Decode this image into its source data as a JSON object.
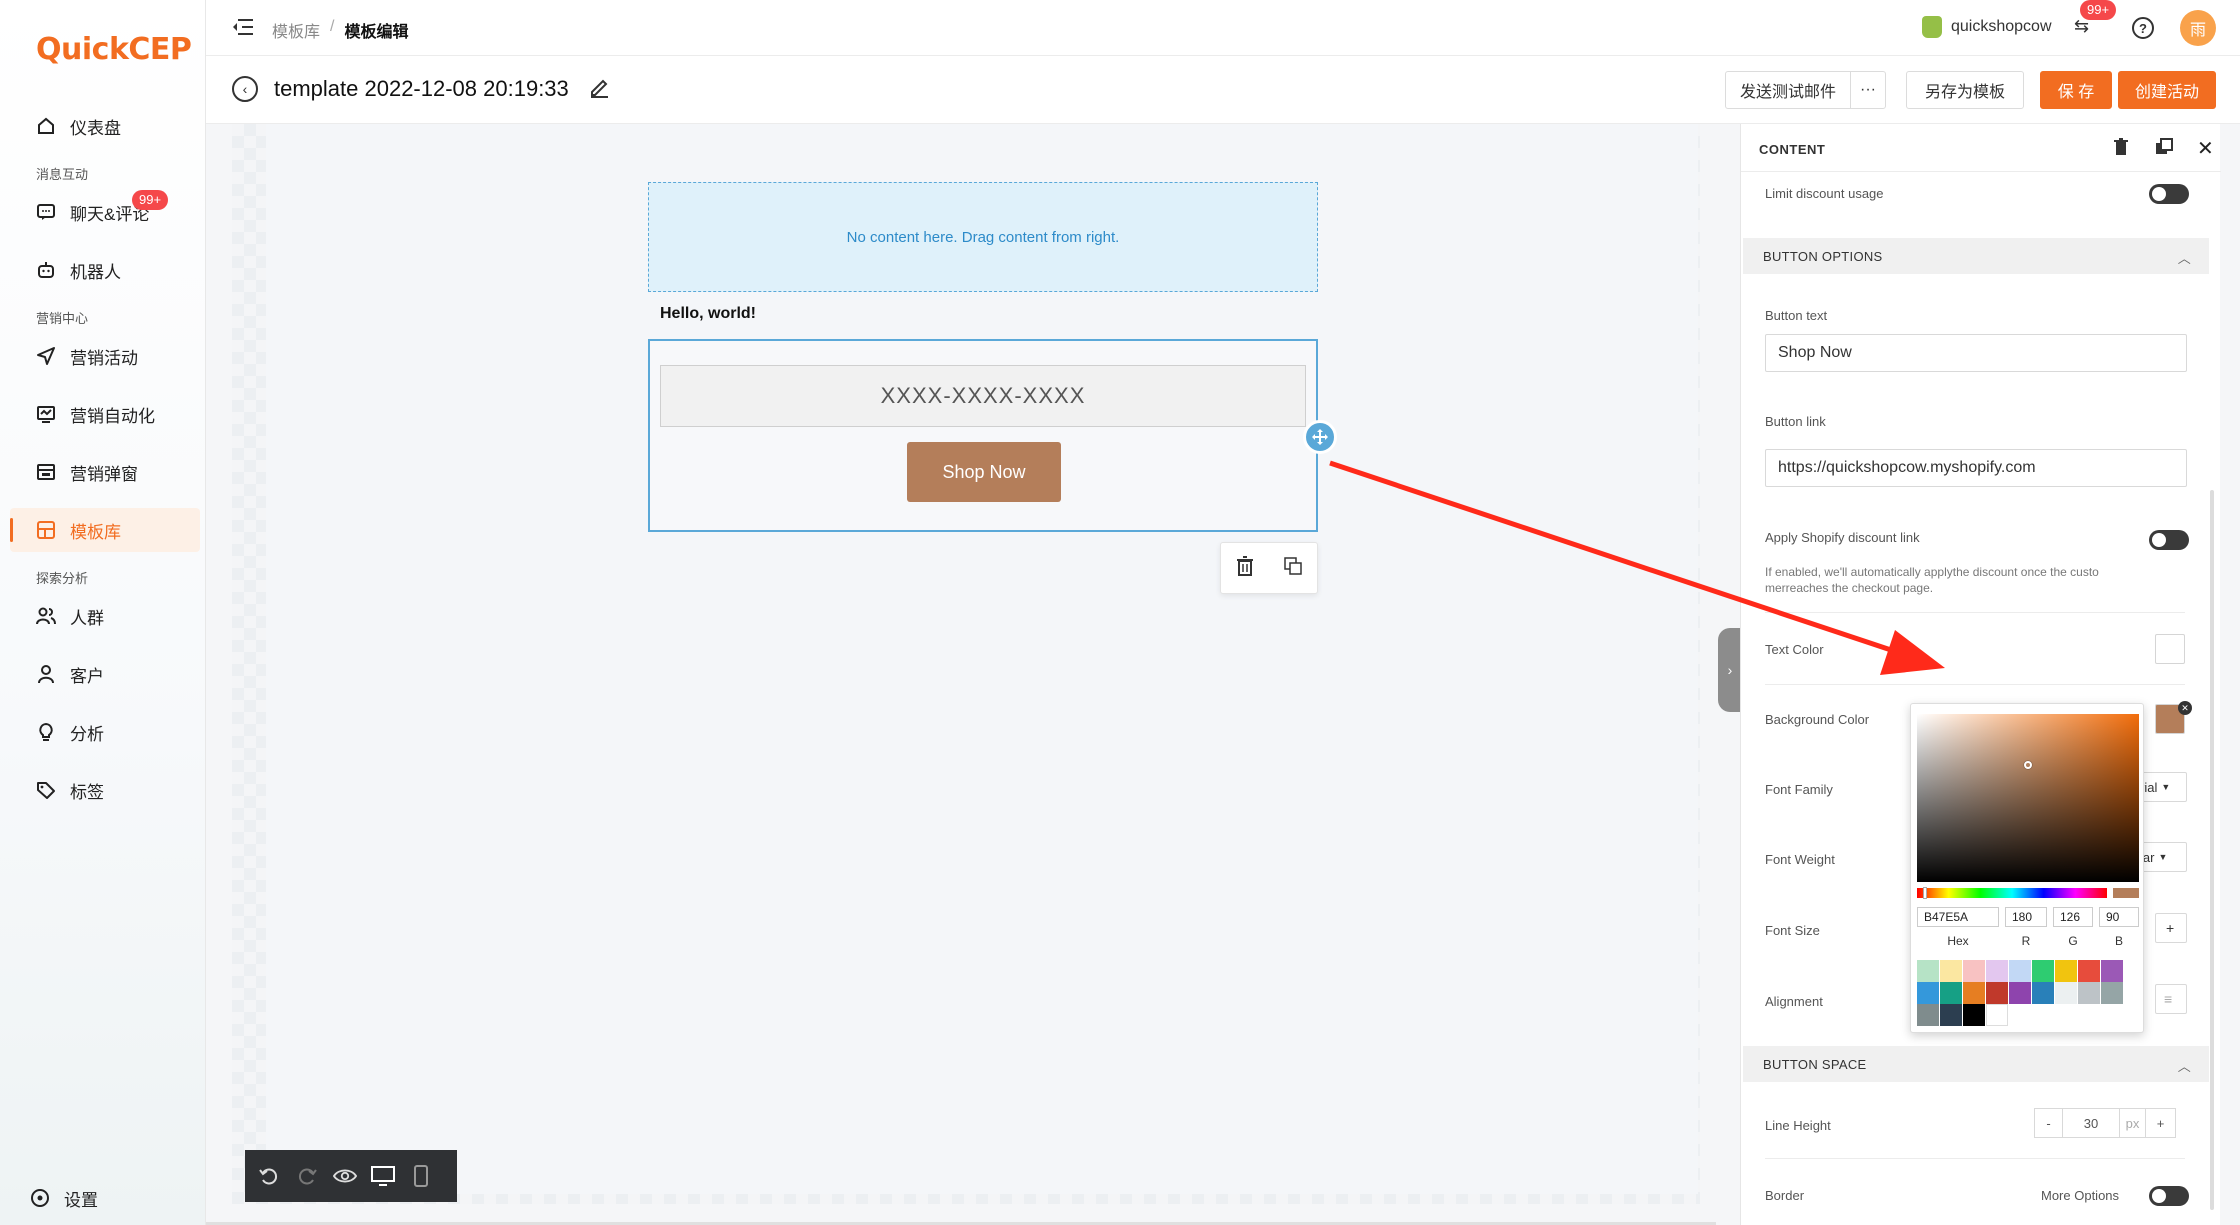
{
  "app": {
    "logo_q": "Q",
    "logo_uick": "uick",
    "logo_cep": "CEP"
  },
  "sidebar": {
    "items": [
      {
        "label": "仪表盘",
        "icon": "home-icon"
      },
      {
        "group": "消息互动"
      },
      {
        "label": "聊天&评论",
        "icon": "chat-icon",
        "badge": "99+"
      },
      {
        "label": "机器人",
        "icon": "robot-icon"
      },
      {
        "group": "营销中心"
      },
      {
        "label": "营销活动",
        "icon": "send-icon"
      },
      {
        "label": "营销自动化",
        "icon": "automation-icon"
      },
      {
        "label": "营销弹窗",
        "icon": "popup-icon"
      },
      {
        "label": "模板库",
        "icon": "template-icon",
        "active": true
      },
      {
        "group": "探索分析"
      },
      {
        "label": "人群",
        "icon": "group-icon"
      },
      {
        "label": "客户",
        "icon": "user-icon"
      },
      {
        "label": "分析",
        "icon": "bulb-icon"
      },
      {
        "label": "标签",
        "icon": "tag-icon"
      }
    ],
    "settings_label": "设置"
  },
  "topbar": {
    "breadcrumb_parent": "模板库",
    "breadcrumb_sep": "/",
    "breadcrumb_current": "模板编辑",
    "store_name": "quickshopcow",
    "notif_badge": "99+",
    "avatar_text": "雨"
  },
  "titlebar": {
    "title": "template 2022-12-08 20:19:33",
    "send_test_label": "发送测试邮件",
    "more_label": "···",
    "save_as_template_label": "另存为模板",
    "save_label": "保 存",
    "create_campaign_label": "创建活动"
  },
  "canvas": {
    "dropzone_text": "No content here. Drag content from right.",
    "hello_text": "Hello, world!",
    "code_placeholder": "XXXX-XXXX-XXXX",
    "shop_button_text": "Shop Now"
  },
  "panel": {
    "header": "CONTENT",
    "limit_discount_label": "Limit discount usage",
    "button_options_header": "BUTTON OPTIONS",
    "button_text_label": "Button text",
    "button_text_value": "Shop Now",
    "button_link_label": "Button link",
    "button_link_value": "https://quickshopcow.myshopify.com",
    "apply_shopify_label": "Apply Shopify discount link",
    "apply_shopify_desc_1": "If enabled, we'll automatically applythe discount once the custo",
    "apply_shopify_desc_2": "merreaches the checkout page.",
    "text_color_label": "Text Color",
    "background_color_label": "Background Color",
    "font_family_label": "Font Family",
    "font_family_value_partial": "rial",
    "font_weight_label": "Font Weight",
    "font_weight_value_partial": "lar",
    "font_size_label": "Font Size",
    "alignment_label": "Alignment",
    "button_space_header": "BUTTON SPACE",
    "line_height_label": "Line Height",
    "line_height_minus": "-",
    "line_height_value": "30",
    "line_height_unit": "px",
    "line_height_plus": "+",
    "font_size_plus": "+",
    "border_label": "Border",
    "more_options_label": "More Options"
  },
  "color_picker": {
    "hex_value": "B47E5A",
    "r_value": "180",
    "g_value": "126",
    "b_value": "90",
    "hex_label": "Hex",
    "r_label": "R",
    "g_label": "G",
    "b_label": "B",
    "current_color": "#b47e5a",
    "presets": [
      "#b6e3c6",
      "#fbe7a1",
      "#f8c2c2",
      "#e3c7ef",
      "#c2d8f5",
      "#2ecc71",
      "#f1c40f",
      "#e74c3c",
      "#9b59b6",
      "#3498db",
      "#16a085",
      "#e67e22",
      "#c0392b",
      "#8e44ad",
      "#2980b9",
      "#ecf0f1",
      "#bdc3c7",
      "#95a5a6",
      "#7f8c8d",
      "#2c3e50",
      "#000000",
      "#ffffff"
    ]
  },
  "colors": {
    "accent": "#f26d21",
    "select_blue": "#5aa8d8",
    "arrow_red": "#ff2a1a"
  }
}
